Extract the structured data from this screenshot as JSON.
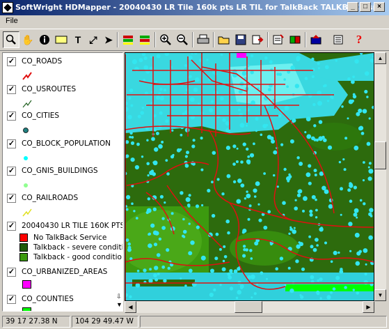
{
  "window": {
    "title": "SoftWright HDMapper - 20040430 LR Tile 160k pts LR TIL for TalkBack TALKBACK.smf"
  },
  "menu": {
    "file": "File"
  },
  "toolbar": {
    "icons": [
      "zoom-tool-icon",
      "pan-hand-icon",
      "info-icon",
      "label-tool-icon",
      "text-tool-icon",
      "line-tool-icon",
      "select-arrow-icon",
      "layers-icon",
      "layers-alt-icon",
      "zoom-in-icon",
      "zoom-out-icon",
      "print-icon",
      "open-folder-icon",
      "save-icon",
      "export-icon",
      "properties-icon",
      "layer-edit-icon",
      "add-layer-icon",
      "layer-list-icon",
      "help-icon"
    ]
  },
  "legend": {
    "layers": [
      {
        "name": "CO_ROADS",
        "checked": true,
        "symbol": "red-line"
      },
      {
        "name": "CO_USROUTES",
        "checked": true,
        "symbol": "green-line"
      },
      {
        "name": "CO_CITIES",
        "checked": true,
        "symbol": "teal-dot"
      },
      {
        "name": "CO_BLOCK_POPULATION",
        "checked": true,
        "symbol": "cyan-dot"
      },
      {
        "name": "CO_GNIS_BUILDINGS",
        "checked": true,
        "symbol": "lightgreen-dot"
      },
      {
        "name": "CO_RAILROADS",
        "checked": true,
        "symbol": "yellow-line"
      },
      {
        "name": "20040430 LR TILE 160K PTS",
        "checked": true,
        "symbol": "categories"
      },
      {
        "name": "CO_URBANIZED_AREAS",
        "checked": true,
        "symbol": "magenta-fill"
      },
      {
        "name": "CO_COUNTIES",
        "checked": true,
        "symbol": "green-fill"
      }
    ],
    "categories": [
      {
        "label": "No TalkBack Service",
        "color": "#ff0000"
      },
      {
        "label": "Talkback - severe conditio",
        "color": "#1f5a0a"
      },
      {
        "label": "Talkback - good conditio",
        "color": "#3c9a0f"
      }
    ]
  },
  "status": {
    "lat": "39 17 27.38 N",
    "lon": "104 29 49.47 W"
  },
  "colors": {
    "road": "#e01010",
    "population": "#00ffff",
    "urban": "#ff00ff",
    "county": "#00ff00"
  }
}
